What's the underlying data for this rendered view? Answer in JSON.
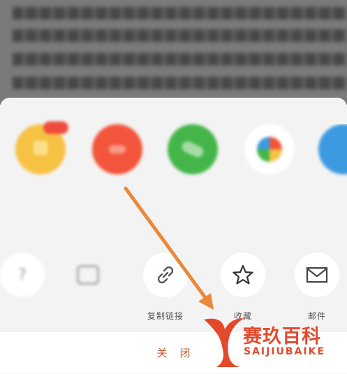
{
  "share_apps": [
    {
      "label": "",
      "color": "#f6c244",
      "icon": "qq-icon"
    },
    {
      "label": "",
      "color": "#f2553c",
      "icon": "weibo-icon"
    },
    {
      "label": "",
      "color": "#44b649",
      "icon": "wechat-icon"
    },
    {
      "label": "",
      "color": "#ffffff",
      "icon": "moments-icon"
    },
    {
      "label": "",
      "color": "#3b9ae0",
      "icon": "app-icon"
    }
  ],
  "actions": [
    {
      "label": "",
      "icon": "font-size-icon"
    },
    {
      "label": "",
      "icon": "report-icon"
    },
    {
      "label": "复制链接",
      "icon": "link-icon"
    },
    {
      "label": "收藏",
      "icon": "star-icon"
    },
    {
      "label": "邮件",
      "icon": "mail-icon"
    }
  ],
  "close_label": "关闭",
  "watermark": {
    "title": "赛玖百科",
    "subtitle": "SAIJIUBAIKE"
  },
  "colors": {
    "accent": "#e9893a",
    "close_text": "#c0562a",
    "watermark": "#e34a2c"
  }
}
